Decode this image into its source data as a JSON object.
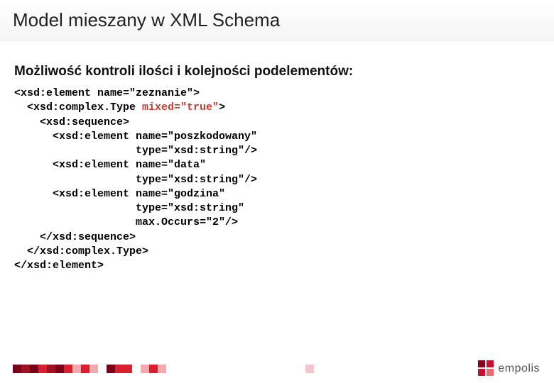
{
  "title": "Model mieszany w XML Schema",
  "subheading": "Możliwość kontroli ilości i kolejności podelementów:",
  "code": {
    "l1a": "<xsd:element name=\"zeznanie\">",
    "l2a": "  <xsd:complex.Type ",
    "l2hl": "mixed=\"true\"",
    "l2b": ">",
    "l3": "    <xsd:sequence>",
    "l4": "      <xsd:element name=\"poszkodowany\"",
    "l5": "                   type=\"xsd:string\"/>",
    "l6": "      <xsd:element name=\"data\"",
    "l7": "                   type=\"xsd:string\"/>",
    "l8": "      <xsd:element name=\"godzina\"",
    "l9": "                   type=\"xsd:string\"",
    "l10": "                   max.Occurs=\"2\"/>",
    "l11": "    </xsd:sequence>",
    "l12": "  </xsd:complex.Type>",
    "l13": "</xsd:element>"
  },
  "brand": {
    "name": "empolis"
  }
}
